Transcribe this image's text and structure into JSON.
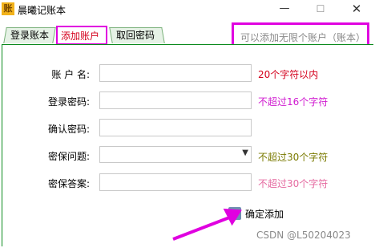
{
  "window": {
    "icon_glyph": "账",
    "title": "晨曦记账本",
    "min_symbol": "—",
    "max_symbol": "☐",
    "close_symbol": "✕"
  },
  "tabs": [
    {
      "label": "登录账本",
      "selected": false
    },
    {
      "label": "添加账户",
      "selected": true
    },
    {
      "label": "取回密码",
      "selected": false
    }
  ],
  "note": "可以添加无限个账户（账本）",
  "form": {
    "account_label": "账 户 名:",
    "account_value": "",
    "account_hint": "20个字符以内",
    "password_label": "登录密码:",
    "password_value": "",
    "password_hint": "不超过16个字符",
    "confirm_label": "确认密码:",
    "confirm_value": "",
    "question_label": "密保问题:",
    "question_value": "",
    "question_hint": "不超过30个字符",
    "answer_label": "密保答案:",
    "answer_value": "",
    "answer_hint": "不超过30个字符"
  },
  "actions": {
    "confirm_button": "确定添加"
  },
  "watermark": "CSDN @L50204023",
  "colors": {
    "highlight_magenta": "#e000e0",
    "panel_border_green": "#0b8a1d",
    "hint_red": "#d4001c",
    "hint_magenta": "#d01ad0",
    "hint_olive": "#7a7a00",
    "hint_pink": "#e56aa0",
    "tab_selected_text": "#d4001c"
  }
}
